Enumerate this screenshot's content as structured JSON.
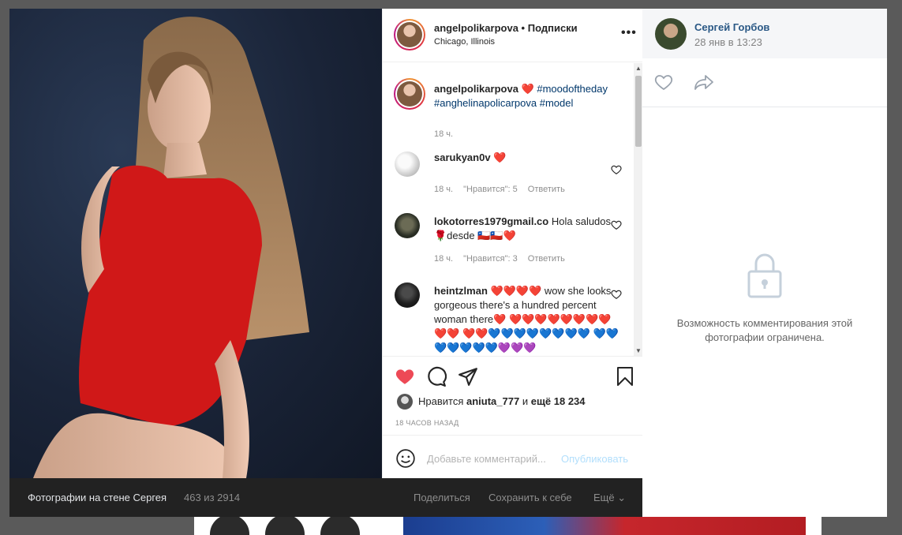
{
  "post": {
    "username": "angelpolikarpova",
    "separator": "•",
    "follow_label": "Подписки",
    "location": "Chicago, Illinois",
    "more_label": "•••"
  },
  "caption": {
    "username": "angelpolikarpova",
    "heart": "❤️",
    "hashtag1": "#moodoftheday",
    "hashtag2": "#anghelinapolicarpova",
    "hashtag3": "#model",
    "time": "18 ч."
  },
  "comments": [
    {
      "username": "sarukyan0v",
      "text": "❤️",
      "time": "18 ч.",
      "likes": "\"Нравится\": 5",
      "reply": "Ответить"
    },
    {
      "username": "lokotorres1979gmail.co",
      "text": "Hola saludos 🌹desde 🇨🇱🇨🇱❤️",
      "time": "18 ч.",
      "likes": "\"Нравится\": 3",
      "reply": "Ответить"
    },
    {
      "username": "heintzlman",
      "text": "❤️❤️❤️❤️ wow she looks gorgeous there's a hundred percent woman there❤️ ❤️❤️❤️❤️❤️❤️❤️❤️❤️❤️ ❤️❤️💙💙💙💙💙💙💙💙 💙💙💙💙💙💙💙💜💜💜"
    }
  ],
  "likes": {
    "prefix": "Нравится",
    "user": "aniuta_777",
    "middle": "и",
    "count": "ещё 18 234"
  },
  "post_time": "18 ЧАСОВ НАЗАД",
  "comment_box": {
    "placeholder": "Добавьте комментарий...",
    "publish": "Опубликовать"
  },
  "bottom_bar": {
    "title": "Фотографии на стене Сергея",
    "counter": "463 из 2914",
    "share": "Поделиться",
    "save": "Сохранить к себе",
    "more": "Ещё ⌄"
  },
  "vk": {
    "author": "Сергей Горбов",
    "date": "28 янв в 13:23",
    "restricted_message": "Возможность комментирования этой фотографии ограничена."
  },
  "colors": {
    "like_red": "#ed4956",
    "vk_link": "#2a5885",
    "bottom_bar": "#222222"
  }
}
